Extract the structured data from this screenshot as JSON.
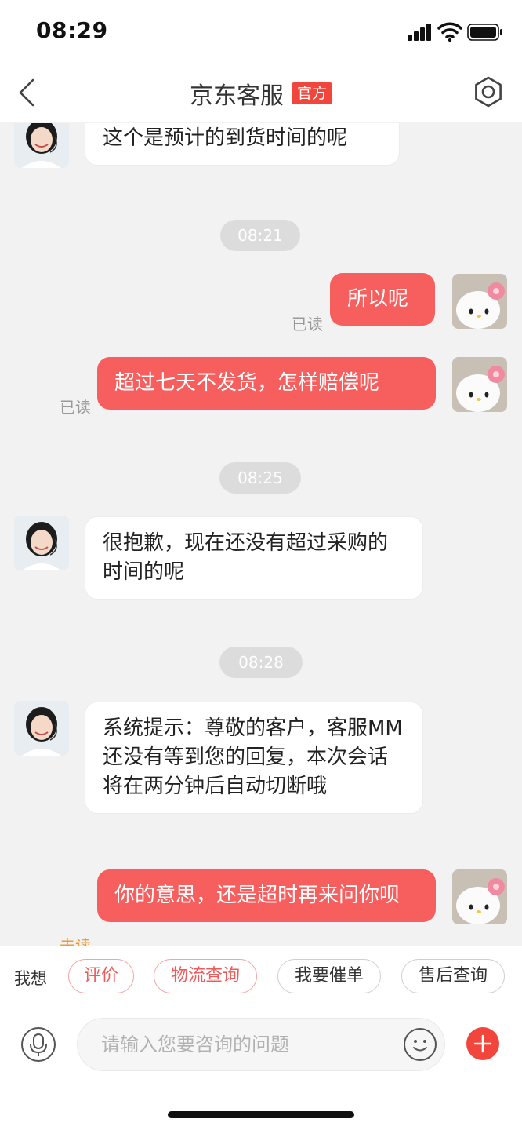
{
  "status_bar": {
    "time": "08:29"
  },
  "nav": {
    "title": "京东客服",
    "badge": "官方"
  },
  "messages": [
    {
      "text": "这个是预计的到货时间的呢"
    },
    {
      "time": "08:21"
    },
    {
      "text": "所以呢",
      "status": "已读"
    },
    {
      "text": "超过七天不发货，怎样赔偿呢",
      "status": "已读"
    },
    {
      "time": "08:25"
    },
    {
      "text": "很抱歉，现在还没有超过采购的时间的呢"
    },
    {
      "time": "08:28"
    },
    {
      "text": "系统提示：尊敬的客户，客服MM还没有等到您的回复，本次会话将在两分钟后自动切断哦"
    },
    {
      "text": "你的意思，还是超时再来问你呗",
      "status": "未读"
    }
  ],
  "quick_actions": {
    "label": "我想",
    "items": [
      "评价",
      "物流查询",
      "我要催单",
      "售后查询"
    ]
  },
  "input": {
    "placeholder": "请输入您要咨询的问题"
  },
  "colors": {
    "accent_red": "#f2453c",
    "outgoing_bubble": "#f75e5e",
    "unread_orange": "#f39a2e"
  }
}
